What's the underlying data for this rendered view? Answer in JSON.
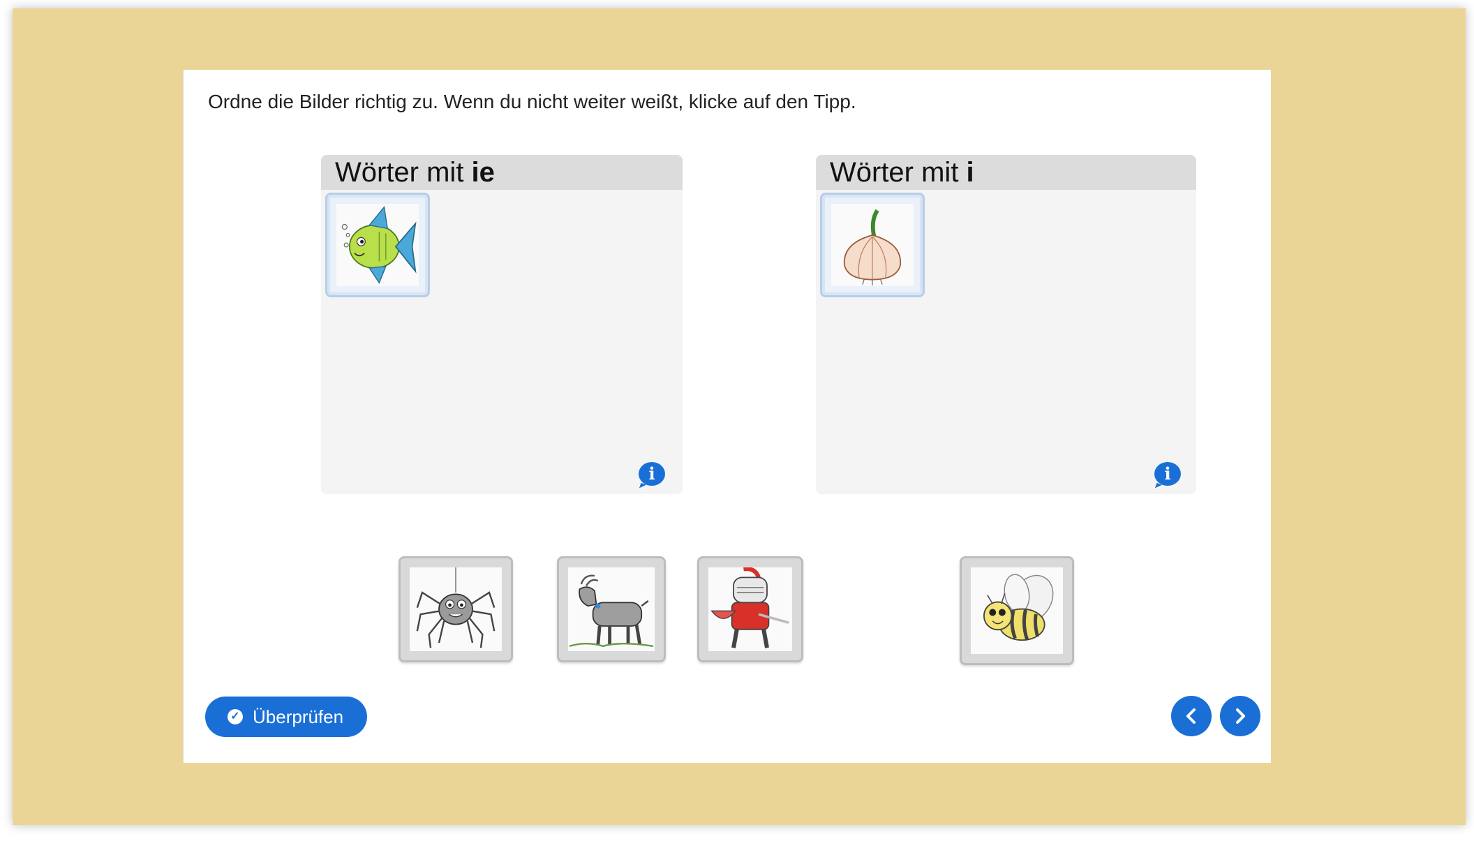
{
  "instruction": "Ordne die Bilder richtig zu. Wenn du nicht weiter weißt, klicke auf den Tipp.",
  "zones": [
    {
      "title_prefix": "Wörter mit ",
      "title_bold": "ie",
      "placed_item_icon": "fish-icon",
      "tip_icon": "info-icon"
    },
    {
      "title_prefix": "Wörter mit ",
      "title_bold": "i",
      "placed_item_icon": "onion-icon",
      "tip_icon": "info-icon"
    }
  ],
  "pool_items": [
    {
      "icon": "spider-icon"
    },
    {
      "icon": "goat-icon"
    },
    {
      "icon": "knight-icon"
    },
    {
      "icon": "bee-icon"
    }
  ],
  "buttons": {
    "check_label": "Überprüfen",
    "check_icon": "check-circle-icon",
    "prev_icon": "chevron-left-icon",
    "next_icon": "chevron-right-icon"
  },
  "colors": {
    "backdrop": "#ebd596",
    "accent": "#1a6fd6",
    "zone_bg": "#f4f4f4",
    "zone_header": "#dcdcdc"
  }
}
